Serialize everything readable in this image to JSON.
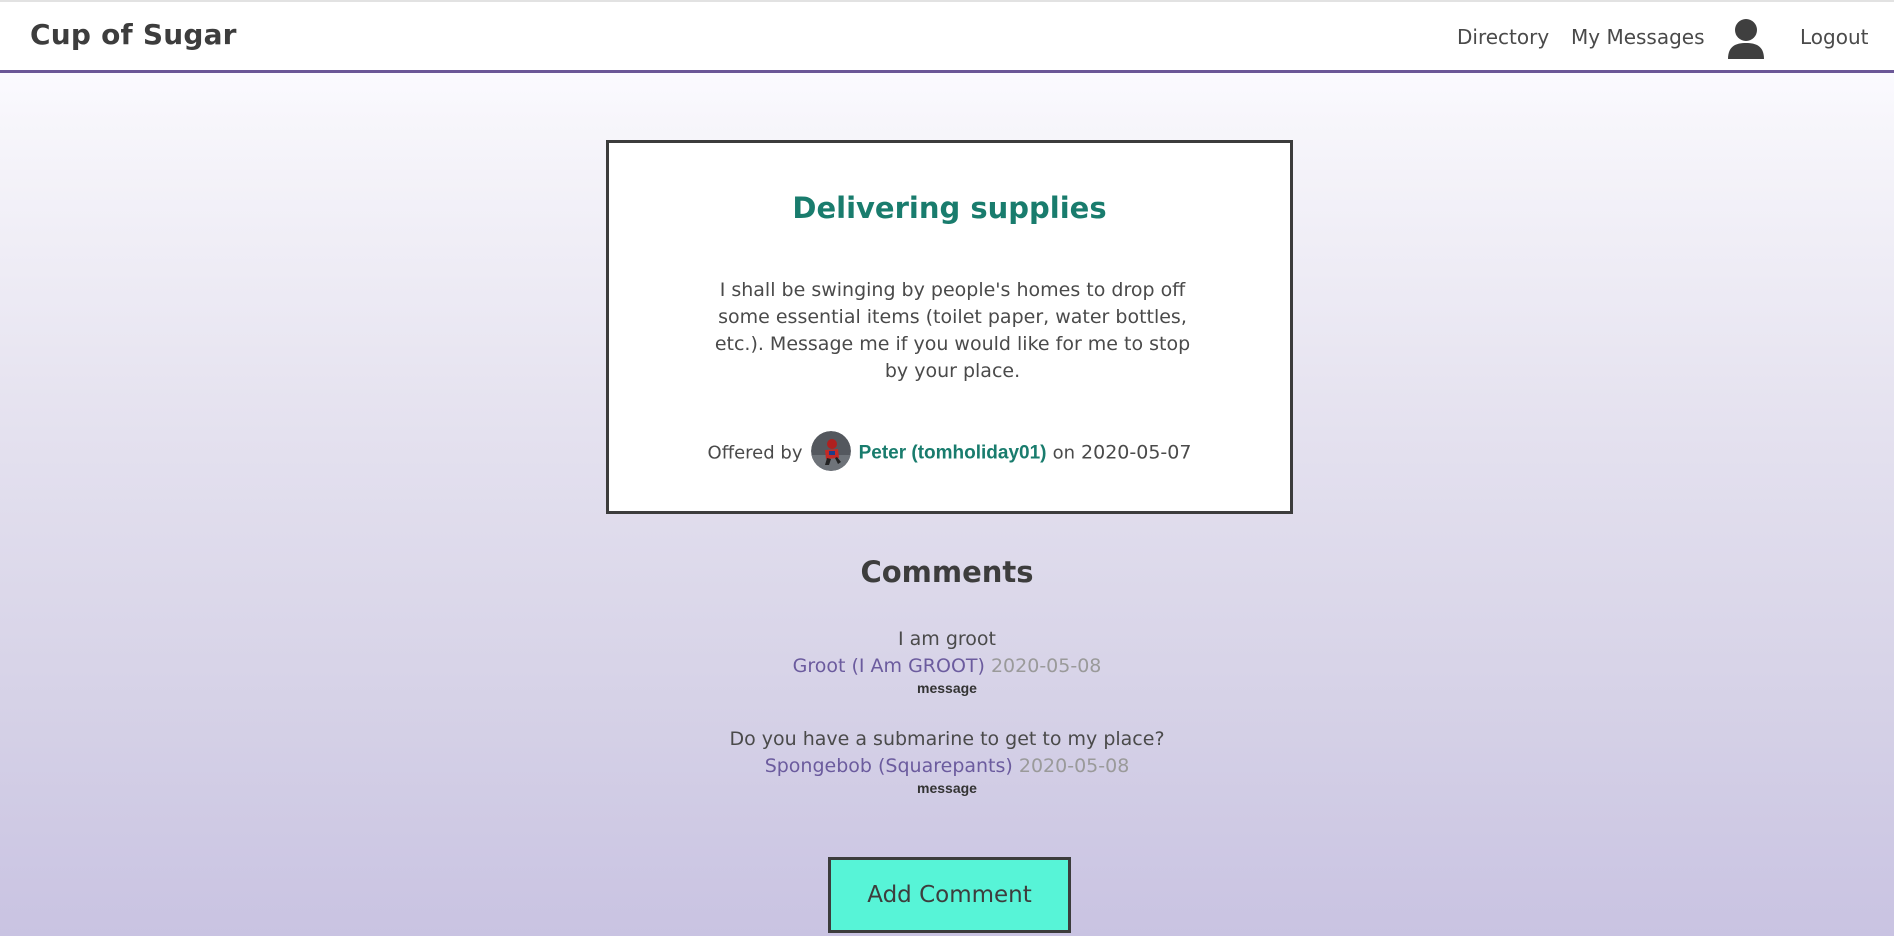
{
  "header": {
    "brand": "Cup of Sugar",
    "nav": {
      "directory": "Directory",
      "my_messages": "My Messages",
      "profile_icon": "user-icon",
      "logout": "Logout"
    }
  },
  "offer": {
    "title": "Delivering supplies",
    "description": "I shall be swinging by people's homes to drop off some essential items (toilet paper, water bottles, etc.). Message me if you would like for me to stop by your place.",
    "offered_by_label": "Offered by",
    "owner_name": "Peter (tomholiday01)",
    "on_label": "on",
    "date": "2020-05-07"
  },
  "comments": {
    "title": "Comments",
    "items": [
      {
        "text": "I am groot",
        "author": "Groot (I Am GROOT)",
        "date": "2020-05-08",
        "message_link": "message"
      },
      {
        "text": "Do you have a submarine to get to my place?",
        "author": "Spongebob (Squarepants)",
        "date": "2020-05-08",
        "message_link": "message"
      }
    ]
  },
  "actions": {
    "add_comment": "Add Comment"
  },
  "colors": {
    "accent_green": "#197c6d",
    "header_border": "#6b5797",
    "button_bg": "#57f4d7",
    "author_link": "#6b5b9e"
  }
}
